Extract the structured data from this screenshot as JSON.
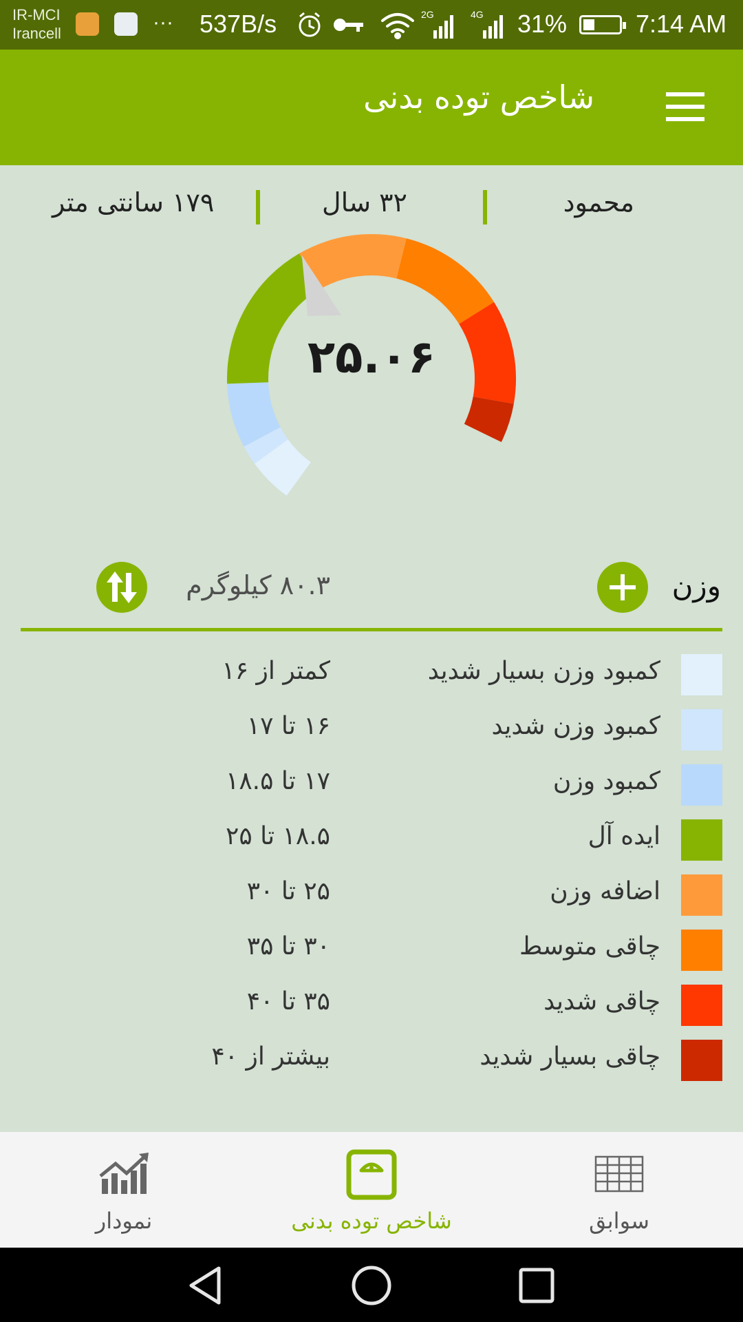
{
  "status_bar": {
    "carrier_line1": "IR-MCI",
    "carrier_line2": "Irancell",
    "dots": "···",
    "net_speed": "537B/s",
    "net_2g": "2G",
    "net_4g": "4G",
    "battery_pct": "31%",
    "time": "7:14 AM"
  },
  "app_bar": {
    "title": "شاخص توده بدنی"
  },
  "profile": {
    "name": "محمود",
    "age": "۳۲ سال",
    "height": "۱۷۹ سانتی متر"
  },
  "gauge": {
    "value_label": "۲۵.۰۶",
    "bmi": 25.06
  },
  "weight": {
    "label": "وزن",
    "value": "۸۰.۳ کیلوگرم"
  },
  "legend": [
    {
      "label": "کمبود وزن بسیار شدید",
      "range": "کمتر از ۱۶",
      "color": "#e3f1fd"
    },
    {
      "label": "کمبود وزن شدید",
      "range": "۱۶ تا ۱۷",
      "color": "#cfe6fc"
    },
    {
      "label": "کمبود وزن",
      "range": "۱۷ تا ۱۸.۵",
      "color": "#b8d9fb"
    },
    {
      "label": "ایده آل",
      "range": "۱۸.۵ تا ۲۵",
      "color": "#87b402"
    },
    {
      "label": "اضافه وزن",
      "range": "۲۵ تا ۳۰",
      "color": "#ff9a3a"
    },
    {
      "label": "چاقی متوسط",
      "range": "۳۰ تا ۳۵",
      "color": "#ff7f00"
    },
    {
      "label": "چاقی شدید",
      "range": "۳۵ تا ۴۰",
      "color": "#ff3700"
    },
    {
      "label": "چاقی بسیار شدید",
      "range": "بیشتر از ۴۰",
      "color": "#cc2900"
    }
  ],
  "bottom_nav": [
    {
      "label": "سوابق",
      "icon": "grid-table-icon",
      "active": false
    },
    {
      "label": "شاخص توده بدنی",
      "icon": "scale-icon",
      "active": true
    },
    {
      "label": "نمودار",
      "icon": "trend-chart-icon",
      "active": false
    }
  ],
  "colors": {
    "accent": "#87b402",
    "status_bar": "#526b05",
    "background": "#d4e1d3"
  }
}
